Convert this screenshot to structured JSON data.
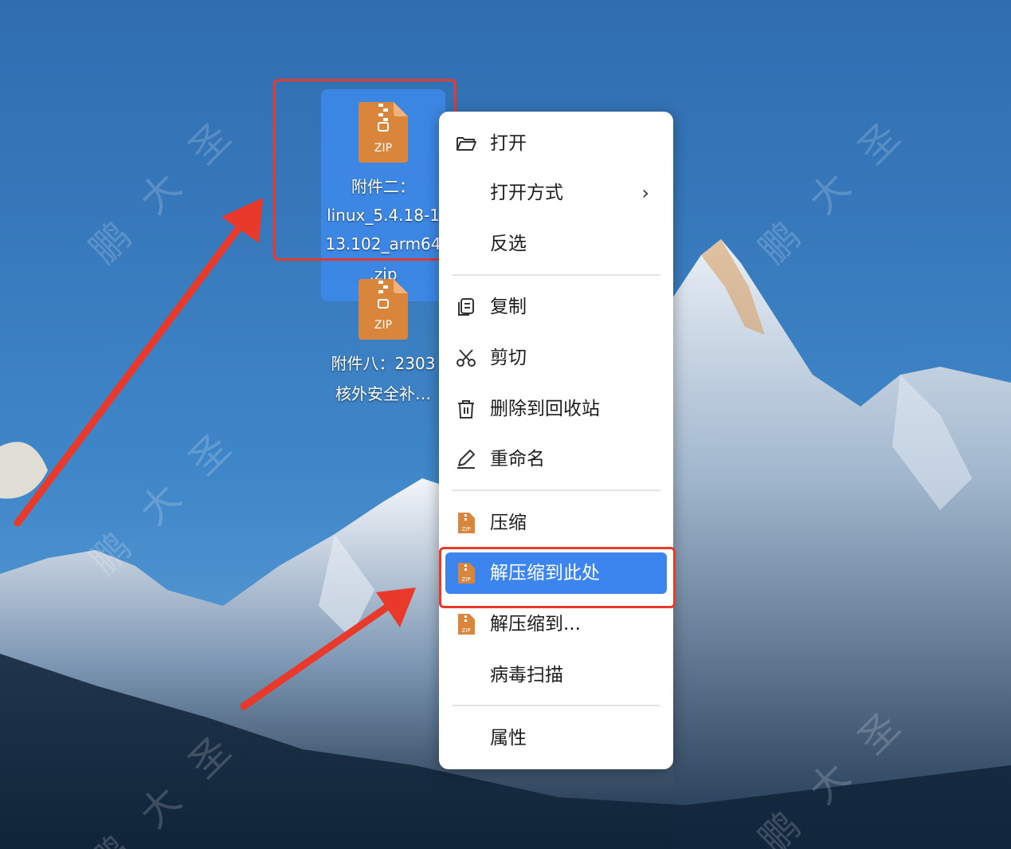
{
  "desktop": {
    "files": [
      {
        "label_lines": [
          "附件二：",
          "linux_5.4.18-1",
          "13.102_arm64",
          ".zip"
        ],
        "icon": "zip-archive-icon",
        "icon_text": "ZIP",
        "selected": true
      },
      {
        "label_lines": [
          "附件八：2303",
          "核外安全补…"
        ],
        "icon": "zip-archive-icon",
        "icon_text": "ZIP",
        "selected": false
      }
    ]
  },
  "context_menu": {
    "items": [
      {
        "label": "打开",
        "icon": "folder-open-icon"
      },
      {
        "label": "打开方式",
        "icon": "",
        "submenu": "›"
      },
      {
        "label": "反选",
        "icon": ""
      },
      {
        "label": "复制",
        "icon": "copy-icon"
      },
      {
        "label": "剪切",
        "icon": "scissors-icon"
      },
      {
        "label": "删除到回收站",
        "icon": "trash-icon"
      },
      {
        "label": "重命名",
        "icon": "pencil-icon"
      },
      {
        "label": "压缩",
        "icon": "zip-archive-icon",
        "icon_text": "ZIP"
      },
      {
        "label": "解压缩到此处",
        "icon": "zip-archive-icon",
        "icon_text": "ZIP",
        "highlighted": true
      },
      {
        "label": "解压缩到...",
        "icon": "zip-archive-icon",
        "icon_text": "ZIP"
      },
      {
        "label": "病毒扫描",
        "icon": ""
      },
      {
        "label": "属性",
        "icon": ""
      }
    ]
  },
  "watermark": "鹏大圣",
  "colors": {
    "highlight": "#3c84ee",
    "annotation_red": "#e8392a",
    "zip_orange": "#d9853b"
  }
}
